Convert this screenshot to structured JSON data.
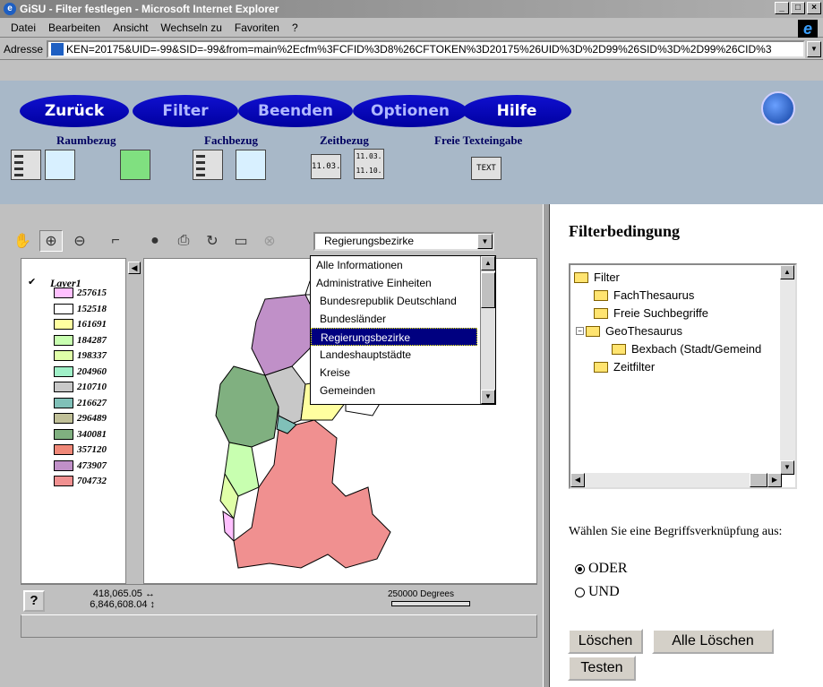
{
  "window": {
    "title": "GiSU - Filter festlegen - Microsoft Internet Explorer",
    "buttons": [
      "_",
      "□",
      "×"
    ]
  },
  "menu": [
    "Datei",
    "Bearbeiten",
    "Ansicht",
    "Wechseln zu",
    "Favoriten",
    "?"
  ],
  "address": {
    "label": "Adresse",
    "url": "KEN=20175&UID=-99&SID=-99&from=main%2Ecfm%3FCFID%3D8%26CFTOKEN%3D20175%26UID%3D%2D99%26SID%3D%2D99%26CID%3"
  },
  "nav": {
    "back": "Zurück",
    "filter": "Filter",
    "quit": "Beenden",
    "options": "Optionen",
    "help": "Hilfe"
  },
  "categories": {
    "space": "Raumbezug",
    "subject": "Fachbezug",
    "time": "Zeitbezug",
    "freetext": "Freie Texteingabe",
    "text_icon": "TEXT",
    "time_icon_1": "11.03.",
    "time_icon_2a": "11.03.",
    "time_icon_2b": "11.10."
  },
  "map": {
    "layer_select": "Regierungsbezirke",
    "dropdown": [
      "Alle Informationen",
      "Administrative Einheiten",
      "Bundesrepublik Deutschland",
      "Bundesländer",
      "Regierungsbezirke",
      "Landeshauptstädte",
      "Kreise",
      "Gemeinden"
    ],
    "dropdown_selected": 4,
    "legend_title": "Layer1",
    "legend": [
      {
        "value": "257615",
        "color": "#ffc0ff"
      },
      {
        "value": "152518",
        "color": "#ffffff"
      },
      {
        "value": "161691",
        "color": "#ffffa0"
      },
      {
        "value": "184287",
        "color": "#c8ffb0"
      },
      {
        "value": "198337",
        "color": "#e0ffa8"
      },
      {
        "value": "204960",
        "color": "#a0f0c8"
      },
      {
        "value": "210710",
        "color": "#c8c8c8"
      },
      {
        "value": "216627",
        "color": "#80c0b8"
      },
      {
        "value": "296489",
        "color": "#c0c098"
      },
      {
        "value": "340081",
        "color": "#80b080"
      },
      {
        "value": "357120",
        "color": "#f08878"
      },
      {
        "value": "473907",
        "color": "#c090c8"
      },
      {
        "value": "704732",
        "color": "#f09090"
      }
    ],
    "coord_x": "418,065.05 ↔",
    "coord_y": "6,846,608.04 ↕",
    "scale": "250000 Degrees",
    "help": "?"
  },
  "filter": {
    "title": "Filterbedingung",
    "tree": [
      {
        "label": "Filter",
        "level": 0
      },
      {
        "label": "FachThesaurus",
        "level": 1
      },
      {
        "label": "Freie Suchbegriffe",
        "level": 1
      },
      {
        "label": "GeoThesaurus",
        "level": 1
      },
      {
        "label": "Bexbach (Stadt/Gemeind",
        "level": 2
      },
      {
        "label": "Zeitfilter",
        "level": 1
      }
    ],
    "prompt": "Wählen Sie eine Begriffsverknüpfung aus:",
    "or": "ODER",
    "and": "UND",
    "delete": "Löschen",
    "delete_all": "Alle Löschen",
    "test": "Testen"
  }
}
